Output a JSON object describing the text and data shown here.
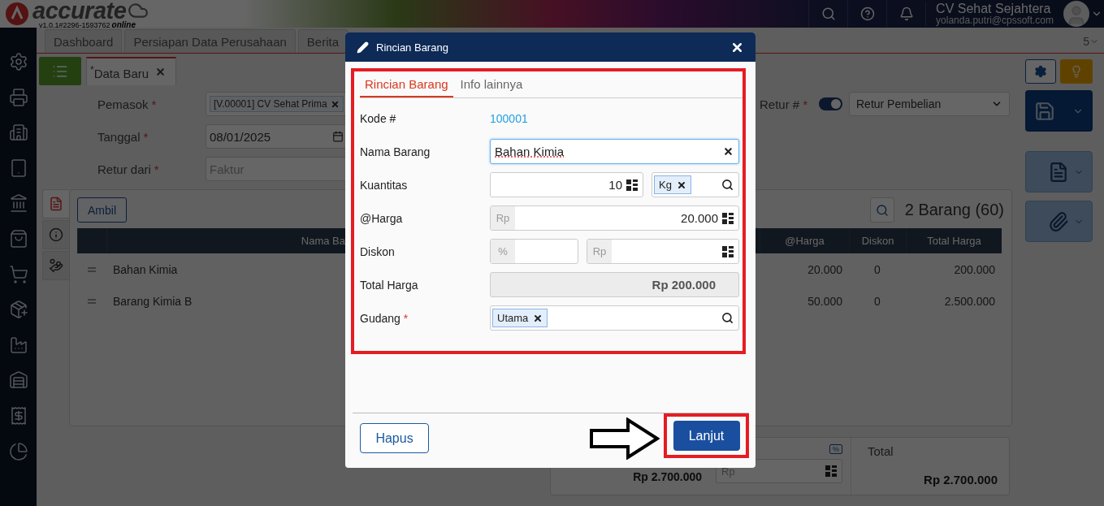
{
  "header": {
    "logo": "accurate",
    "logo_sub": "online",
    "version": "v1.0.1#2296-1593762",
    "company": "CV Sehat Sejahtera",
    "email": "yolanda.putri@cpssoft.com"
  },
  "tabs": [
    {
      "label": "Dashboard",
      "selected": false
    },
    {
      "label": "Persiapan Data Perusahaan",
      "selected": false
    },
    {
      "label": "Berita",
      "selected": false
    }
  ],
  "tab_count": "5",
  "document_tab": {
    "marker": "*",
    "label": "Data Baru"
  },
  "form": {
    "fields": [
      {
        "kind": "tag",
        "label": "Pemasok",
        "required_mark": "*",
        "value": "[V.00001] CV Sehat Prima"
      },
      {
        "kind": "date",
        "label": "Tanggal",
        "required_mark": "*",
        "value": "08/01/2025"
      },
      {
        "kind": "text",
        "label": "Retur dari",
        "required_mark": "*",
        "placeholder": "Faktur"
      }
    ],
    "retur": {
      "label": "Retur #",
      "required_mark": "*",
      "on": true,
      "select": "Retur Pembelian"
    }
  },
  "side_tabs": [
    {
      "kind": "document",
      "selected": true
    },
    {
      "kind": "info",
      "selected": false
    },
    {
      "kind": "money",
      "selected": false
    }
  ],
  "items": {
    "fetch_button": "Ambil",
    "count": "2 Barang (60)",
    "columns": [
      "Nama Ba",
      "@Harga",
      "Diskon",
      "Total Harga"
    ],
    "rows": [
      {
        "name": "Bahan Kimia",
        "price": "20.000",
        "discount": "0",
        "total": "200.000"
      },
      {
        "name": "Barang Kimia B",
        "price": "50.000",
        "discount": "0",
        "total": "2.500.000"
      }
    ]
  },
  "summary": {
    "subtotal": "Rp 2.700.000",
    "percent_badge": "%",
    "discount_prefix": "Rp",
    "total_label": "Total",
    "total": "Rp 2.700.000"
  },
  "dialog": {
    "title": "Rincian Barang",
    "tabs": [
      {
        "label": "Rincian Barang",
        "selected": true
      },
      {
        "label": "Info lainnya",
        "selected": false
      }
    ],
    "fields": [
      {
        "kind": "static",
        "label": "Kode #",
        "value": "100001"
      },
      {
        "kind": "text",
        "label": "Nama Barang",
        "value": "Bahan Kimia"
      },
      {
        "kind": "quantity",
        "label": "Kuantitas",
        "value": "10",
        "unit": "Kg"
      },
      {
        "kind": "price",
        "label": "@Harga",
        "prefix": "Rp",
        "value": "20.000"
      },
      {
        "kind": "discount",
        "label": "Diskon",
        "percent_prefix": "%",
        "amount_prefix": "Rp"
      },
      {
        "kind": "readonly",
        "label": "Total Harga",
        "value": "Rp 200.000"
      },
      {
        "kind": "lookup",
        "label": "Gudang",
        "required_mark": "*",
        "tag": "Utama"
      }
    ],
    "delete_button": "Hapus",
    "next_button": "Lanjut"
  }
}
